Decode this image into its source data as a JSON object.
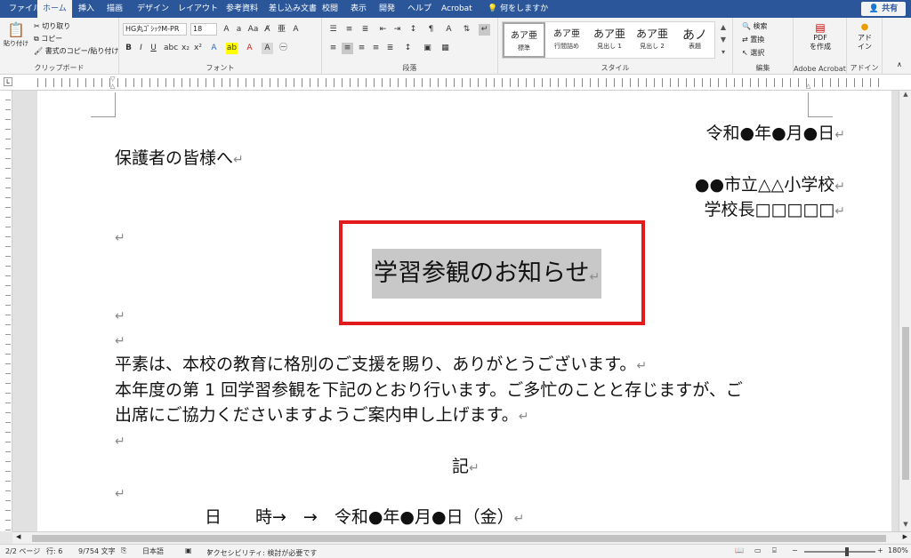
{
  "menu": {
    "tabs": [
      "ファイル",
      "ホーム",
      "挿入",
      "描画",
      "デザイン",
      "レイアウト",
      "参考資料",
      "差し込み文書",
      "校閲",
      "表示",
      "開発",
      "ヘルプ",
      "Acrobat"
    ],
    "tell_me": "何をしますか",
    "share": "共有"
  },
  "ribbon": {
    "clipboard": {
      "paste": "貼り付け",
      "cut": "切り取り",
      "copy": "コピー",
      "format_painter": "書式のコピー/貼り付け",
      "label": "クリップボード"
    },
    "font": {
      "font_name": "HG丸ｺﾞｼｯｸM-PR",
      "font_size": "18",
      "label": "フォント"
    },
    "paragraph": {
      "label": "段落"
    },
    "styles": {
      "items": [
        {
          "preview": "あア亜",
          "name": "標準"
        },
        {
          "preview": "あア亜",
          "name": "行間詰め"
        },
        {
          "preview": "あア亜",
          "name": "見出し 1"
        },
        {
          "preview": "あア亜",
          "name": "見出し 2"
        },
        {
          "preview": "あノ",
          "name": "表題"
        }
      ],
      "label": "スタイル"
    },
    "editing": {
      "find": "検索",
      "replace": "置換",
      "select": "選択",
      "label": "編集"
    },
    "acrobat": {
      "pdf_line1": "PDF",
      "pdf_line2": "を作成",
      "label": "Adobe Acrobat"
    },
    "addins": {
      "line1": "アド",
      "line2": "イン",
      "label": "アドイン"
    }
  },
  "document": {
    "date_line": "令和●年●月●日",
    "addressee": "保護者の皆様へ",
    "school": "●●市立△△小学校",
    "principal": "学校長□□□□□",
    "title": "学習参観のお知らせ",
    "body_line1": "平素は、本校の教育に格別のご支援を賜り、ありがとうございます。",
    "body_line2": "本年度の第 1 回学習参観を下記のとおり行います。ご多忙のことと存じますが、ご",
    "body_line3": "出席にご協力くださいますようご案内申し上げます。",
    "ki": "記",
    "schedule_label": "日　　時→　→　令和●年●月●日（金）",
    "para_mark": "↵"
  },
  "status": {
    "page": "2/2 ページ",
    "line": "行: 6",
    "words": "9/754 文字",
    "language": "日本語",
    "accessibility": "アクセシビリティ: 検討が必要です",
    "zoom": "180%"
  },
  "colors": {
    "menubar": "#2b579a",
    "highlight_box": "#e11b1b",
    "selection": "#c8c8c8"
  }
}
